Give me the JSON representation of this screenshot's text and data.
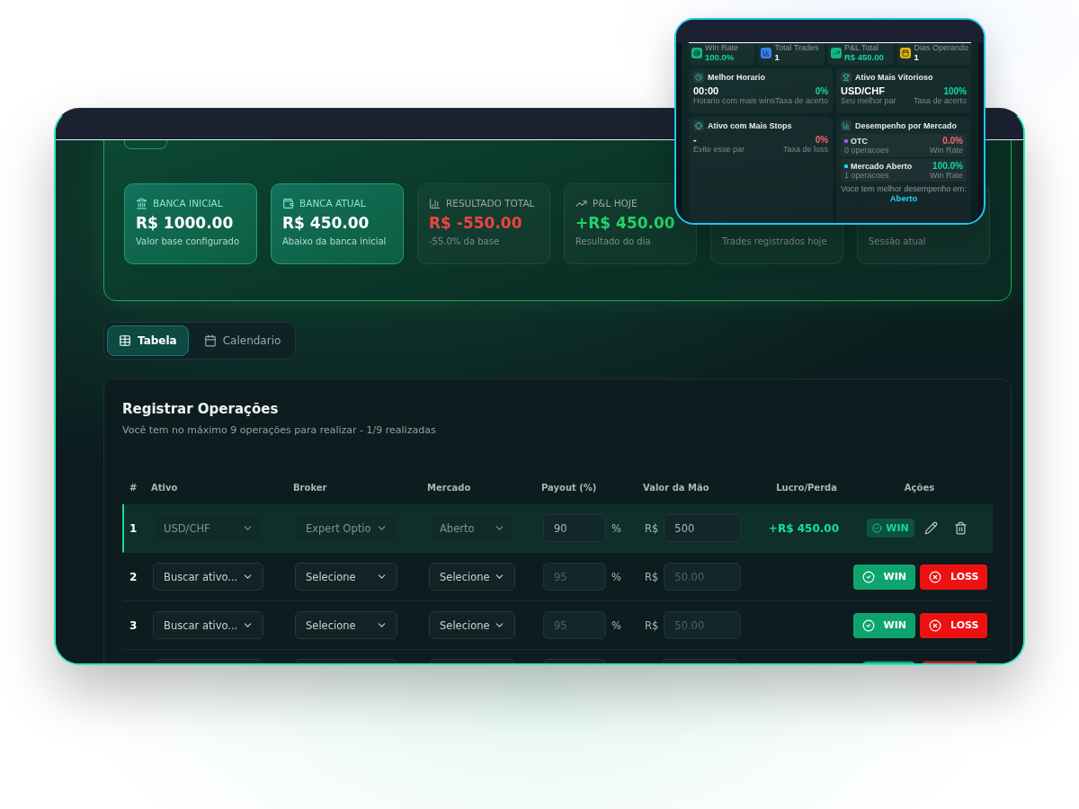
{
  "dashboard": {
    "summary_cards": [
      {
        "highlighted": true,
        "kind": "plain",
        "label": "BANCA INICIAL",
        "value": "R$ 1000.00",
        "note": "Valor base configurado"
      },
      {
        "highlighted": true,
        "kind": "plain",
        "label": "BANCA ATUAL",
        "value": "R$ 450.00",
        "note": "Abaixo da banca inicial"
      },
      {
        "highlighted": false,
        "kind": "loss",
        "label": "RESULTADO TOTAL",
        "value": "R$ -550.00",
        "note": "-55.0% da base"
      },
      {
        "highlighted": false,
        "kind": "gain",
        "label": "P&L HOJE",
        "value": "+R$ 450.00",
        "note": "Resultado do dia"
      },
      {
        "highlighted": false,
        "kind": "plain",
        "note": "Trades registrados hoje"
      },
      {
        "highlighted": false,
        "kind": "loss",
        "note": "Sessão atual"
      }
    ],
    "view_tabs": [
      {
        "label": "Tabela",
        "selected": true
      },
      {
        "label": "Calendario",
        "selected": false
      }
    ],
    "operations": {
      "title": "Registrar Operações",
      "subtitle": "Você tem no máximo 9 operações para realizar - 1/9 realizadas",
      "columns": [
        "#",
        "Ativo",
        "Broker",
        "Mercado",
        "Payout (%)",
        "Valor da Mão",
        "Lucro/Perda",
        "Ações"
      ],
      "rows": [
        {
          "kind": "done",
          "selected": true,
          "number": "1",
          "asset": "USD/CHF",
          "broker": "Expert Optio",
          "market": "Aberto",
          "payout": {
            "value": "90"
          },
          "unit": "%",
          "currency": "R$",
          "amount": {
            "value": "500"
          },
          "result": "+R$ 450.00",
          "outcome": "WIN"
        },
        {
          "kind": "pending",
          "selected": false,
          "number": "2",
          "asset": "Buscar ativo...",
          "broker": "Selecione",
          "market": "Selecione",
          "payout": {
            "placeholder": "95"
          },
          "unit": "%",
          "currency": "R$",
          "amount": {
            "placeholder": "50.00"
          },
          "win_label": "WIN",
          "loss_label": "LOSS"
        },
        {
          "kind": "pending",
          "selected": false,
          "number": "3",
          "asset": "Buscar ativo...",
          "broker": "Selecione",
          "market": "Selecione",
          "payout": {
            "placeholder": "95"
          },
          "unit": "%",
          "currency": "R$",
          "amount": {
            "placeholder": "50.00"
          },
          "win_label": "WIN",
          "loss_label": "LOSS"
        },
        {
          "kind": "clipped",
          "selected": false
        }
      ]
    }
  },
  "stats_preview": {
    "stats": [
      {
        "color": "#10b981",
        "kind": "gain",
        "label": "Win Rate",
        "value": "100.0%"
      },
      {
        "color": "#3b82f6",
        "kind": "plain",
        "label": "Total Trades",
        "value": "1"
      },
      {
        "color": "#10b981",
        "kind": "gain",
        "label": "P&L Total",
        "value": "R$ 450.00"
      },
      {
        "color": "#eab308",
        "kind": "plain",
        "label": "Dias Operando",
        "value": "1"
      }
    ],
    "panels": [
      {
        "kind": "metric",
        "title": "Melhor Horario",
        "value": "00:00",
        "note": "Horario com mais wins",
        "rate": "0%",
        "rate_note": "Taxa de acerto",
        "rate_negative": false
      },
      {
        "kind": "metric",
        "title": "Ativo Mais Vitorioso",
        "value": "USD/CHF",
        "note": "Seu melhor par",
        "rate": "100%",
        "rate_note": "Taxa de acerto",
        "rate_negative": false
      },
      {
        "kind": "metric",
        "title": "Ativo com Mais Stops",
        "value": "-",
        "note": "Evite esse par",
        "rate": "0%",
        "rate_note": "Taxa de loss",
        "rate_negative": true
      },
      {
        "kind": "markets",
        "title": "Desempenho por Mercado",
        "markets": [
          {
            "name": "OTC",
            "color": "#a855f7",
            "count": "0 operacoes",
            "rate": "0.0%",
            "rate_note": "Win Rate",
            "rate_negative": true
          },
          {
            "name": "Mercado Aberto",
            "color": "#22d3ee",
            "count": "1 operacoes",
            "rate": "100.0%",
            "rate_note": "Win Rate",
            "rate_negative": false
          }
        ],
        "footer": "Voce tem melhor desempenho em:",
        "footer_value": "Aberto"
      }
    ]
  }
}
